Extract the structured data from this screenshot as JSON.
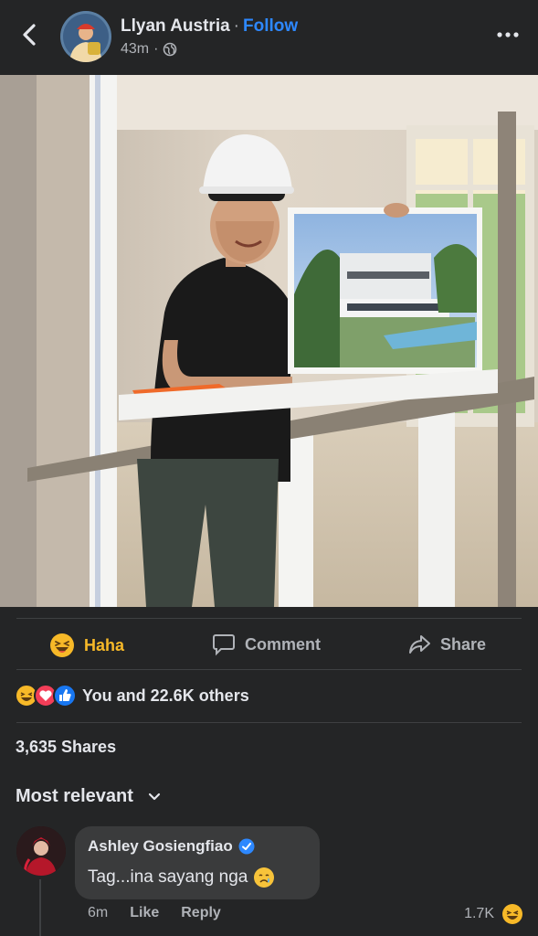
{
  "post": {
    "author": "Llyan Austria",
    "follow_label": "Follow",
    "time": "43m",
    "separator": "·",
    "audience_icon": "globe-icon"
  },
  "actions": {
    "haha_label": "Haha",
    "comment_label": "Comment",
    "share_label": "Share"
  },
  "reactions_summary": {
    "text": "You and 22.6K others",
    "icons": [
      "haha-reaction-icon",
      "love-reaction-icon",
      "like-reaction-icon"
    ]
  },
  "shares_text": "3,635 Shares",
  "sort_label": "Most relevant",
  "comment": {
    "author": "Ashley Gosiengfiao",
    "verified": true,
    "text": "Tag...ina sayang nga",
    "time": "6m",
    "like_label": "Like",
    "reply_label": "Reply",
    "reaction_count": "1.7K"
  },
  "colors": {
    "background": "#242526",
    "accent_blue": "#2d88ff",
    "haha_yellow": "#f7b928",
    "secondary_text": "#b0b3b8",
    "bubble": "#3a3b3c"
  }
}
